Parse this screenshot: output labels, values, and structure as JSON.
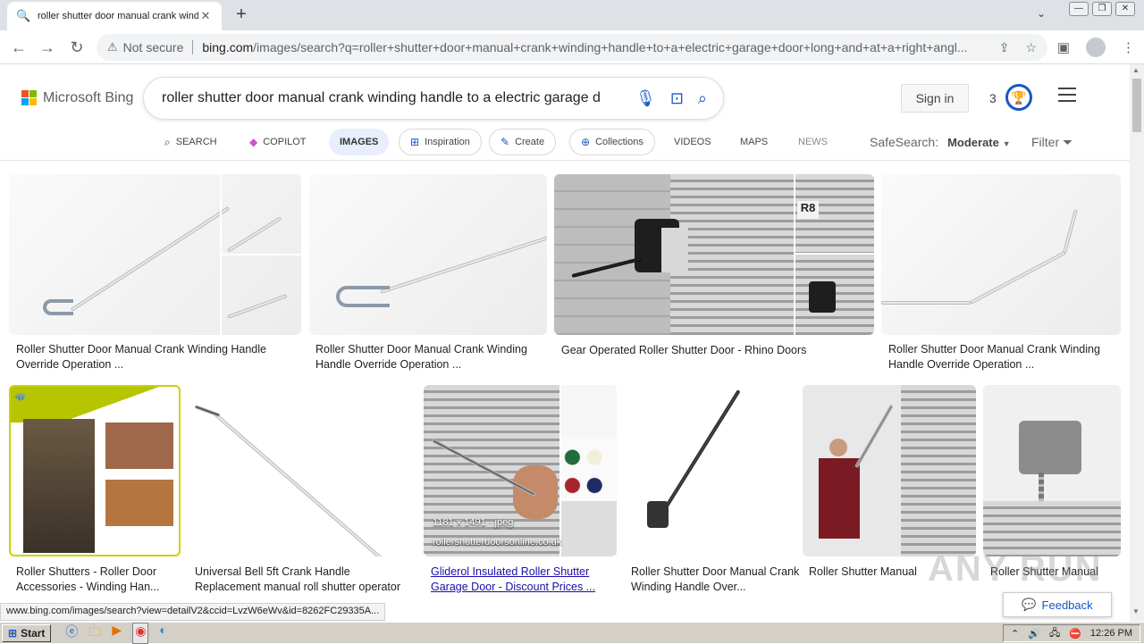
{
  "browser": {
    "tab_title": "roller shutter door manual crank winding handle",
    "tab_close": "✕",
    "new_tab": "+",
    "not_secure": "Not secure",
    "url_host": "bing.com",
    "url_rest": "/images/search?q=roller+shutter+door+manual+crank+winding+handle+to+a+electric+garage+door+long+and+at+a+right+angl...",
    "window_buttons": [
      "—",
      "❐",
      "✕"
    ]
  },
  "bing": {
    "brand": "Microsoft Bing",
    "logo_colors": [
      "#f25022",
      "#7fba00",
      "#00a4ef",
      "#ffb900"
    ],
    "query": "roller shutter door manual crank winding handle to a electric garage d",
    "sign_in": "Sign in",
    "rewards_count": "3",
    "accent": "#1a56c5"
  },
  "scopes": {
    "search": "SEARCH",
    "copilot": "COPILOT",
    "images": "IMAGES",
    "inspiration": "Inspiration",
    "create": "Create",
    "collections": "Collections",
    "videos": "VIDEOS",
    "maps": "MAPS",
    "news": "NEWS",
    "safesearch_label": "SafeSearch:",
    "safesearch_value": "Moderate",
    "filter": "Filter"
  },
  "results": [
    {
      "caption": "Roller Shutter Door Manual Crank Winding Handle Override Operation ..."
    },
    {
      "caption": "Roller Shutter Door Manual Crank Winding Handle Override Operation ..."
    },
    {
      "caption": "Gear Operated Roller Shutter Door - Rhino Doors"
    },
    {
      "caption": "Roller Shutter Door Manual Crank Winding Handle Override Operation ..."
    },
    {
      "caption": "Roller Shutters - Roller Door Accessories - Winding Han..."
    },
    {
      "caption": "Universal Bell 5ft Crank Handle Replacement manual roll shutter operator"
    },
    {
      "caption": "Gliderol Insulated Roller Shutter Garage Door - Discount Prices ...",
      "size": "1181 x 1491 · jpeg",
      "source": "rollershutterdoorsonline.co.uk"
    },
    {
      "caption": "Roller Shutter Door Manual Crank Winding Handle Over..."
    },
    {
      "caption": "Roller Shutter Manual"
    },
    {
      "caption": "Roller Shutter Manual"
    }
  ],
  "feedback": "Feedback",
  "status_url": "www.bing.com/images/search?view=detailV2&ccid=LvzW6eWv&id=8262FC29335A...",
  "watermark": "ANY RUN",
  "taskbar": {
    "start": "Start",
    "time": "12:26 PM"
  }
}
